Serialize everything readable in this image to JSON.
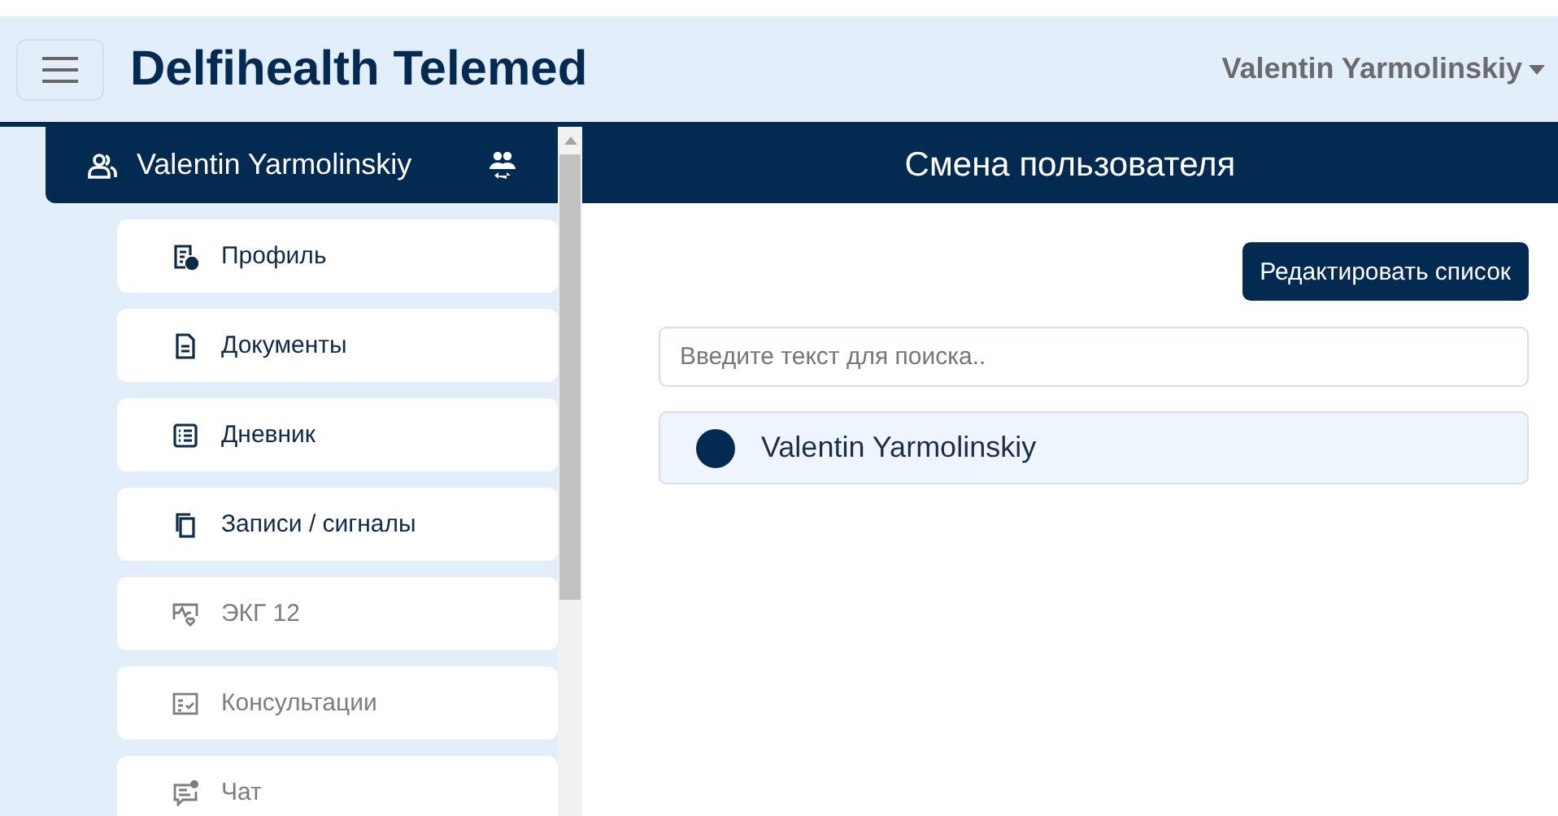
{
  "header": {
    "title": "Delfihealth Telemed",
    "user_menu": "Valentin Yarmolinskiy"
  },
  "sidebar": {
    "current_user": "Valentin Yarmolinskiy",
    "items": [
      {
        "label": "Профиль",
        "disabled": false
      },
      {
        "label": "Документы",
        "disabled": false
      },
      {
        "label": "Дневник",
        "disabled": false
      },
      {
        "label": "Записи / сигналы",
        "disabled": false
      },
      {
        "label": "ЭКГ 12",
        "disabled": true
      },
      {
        "label": "Консультации",
        "disabled": true
      },
      {
        "label": "Чат",
        "disabled": true
      }
    ]
  },
  "main": {
    "title": "Смена пользователя",
    "edit_button": "Редактировать список",
    "search": {
      "placeholder": "Введите текст для поиска.."
    },
    "users": [
      {
        "name": "Valentin Yarmolinskiy",
        "color": "#032a51"
      }
    ]
  }
}
